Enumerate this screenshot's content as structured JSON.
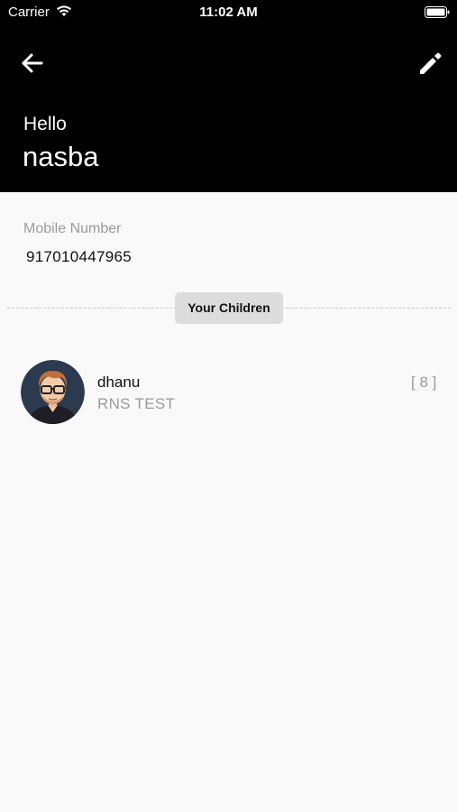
{
  "status_bar": {
    "carrier": "Carrier",
    "time": "11:02 AM"
  },
  "header": {
    "greeting": "Hello",
    "username": "nasba",
    "back_icon": "arrow-left-icon",
    "edit_icon": "pencil-icon"
  },
  "profile": {
    "mobile_label": "Mobile Number",
    "mobile_value": "917010447965"
  },
  "children_section": {
    "label": "Your Children",
    "children": [
      {
        "name": "dhanu",
        "school": "RNS TEST",
        "class_label": "[ 8 ]",
        "avatar_icon": "avatar-icon"
      }
    ]
  },
  "colors": {
    "header_bg": "#000000",
    "body_bg": "#f9f9f9",
    "muted_text": "#9a9a9a",
    "pill_bg": "#dcdcdc"
  }
}
